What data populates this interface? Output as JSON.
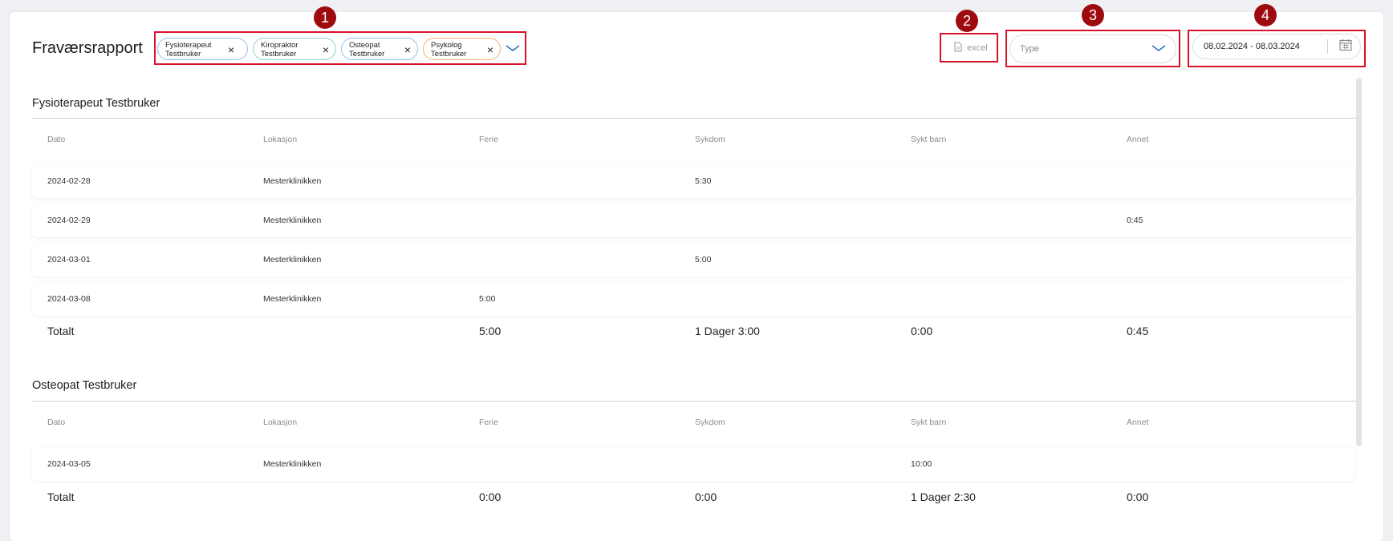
{
  "header": {
    "title": "Fraværsrapport"
  },
  "chips": [
    {
      "label": "Fysioterapeut\nTestbruker"
    },
    {
      "label": "Kiropraktor\nTestbruker"
    },
    {
      "label": "Osteopat\nTestbruker"
    },
    {
      "label": "Psykolog\nTestbruker"
    }
  ],
  "icons": {
    "close": "×",
    "chevron": "﹀"
  },
  "excel": {
    "label": "excel"
  },
  "type_select": {
    "placeholder": "Type"
  },
  "date_range": {
    "value": "08.02.2024 - 08.03.2024"
  },
  "markers": [
    "1",
    "2",
    "3",
    "4"
  ],
  "colors": {
    "callout": "#d9112b",
    "marker": "#9d0b0e",
    "accent_blue": "#2a6fb8"
  },
  "columns": [
    "Dato",
    "Lokasjon",
    "Ferie",
    "Sykdom",
    "Sykt barn",
    "Annet"
  ],
  "sections": [
    {
      "title": "Fysioterapeut Testbruker",
      "rows": [
        {
          "dato": "2024-02-28",
          "lokasjon": "Mesterklinikken",
          "ferie": "",
          "sykdom": "5:30",
          "sykt_barn": "",
          "annet": ""
        },
        {
          "dato": "2024-02-29",
          "lokasjon": "Mesterklinikken",
          "ferie": "",
          "sykdom": "",
          "sykt_barn": "",
          "annet": "0:45"
        },
        {
          "dato": "2024-03-01",
          "lokasjon": "Mesterklinikken",
          "ferie": "",
          "sykdom": "5:00",
          "sykt_barn": "",
          "annet": ""
        },
        {
          "dato": "2024-03-08",
          "lokasjon": "Mesterklinikken",
          "ferie": "5:00",
          "sykdom": "",
          "sykt_barn": "",
          "annet": ""
        }
      ],
      "total": {
        "label": "Totalt",
        "ferie": "5:00",
        "sykdom": "1 Dager 3:00",
        "sykt_barn": "0:00",
        "annet": "0:45"
      }
    },
    {
      "title": "Osteopat Testbruker",
      "rows": [
        {
          "dato": "2024-03-05",
          "lokasjon": "Mesterklinikken",
          "ferie": "",
          "sykdom": "",
          "sykt_barn": "10:00",
          "annet": ""
        }
      ],
      "total": {
        "label": "Totalt",
        "ferie": "0:00",
        "sykdom": "0:00",
        "sykt_barn": "1 Dager 2:30",
        "annet": "0:00"
      }
    }
  ]
}
